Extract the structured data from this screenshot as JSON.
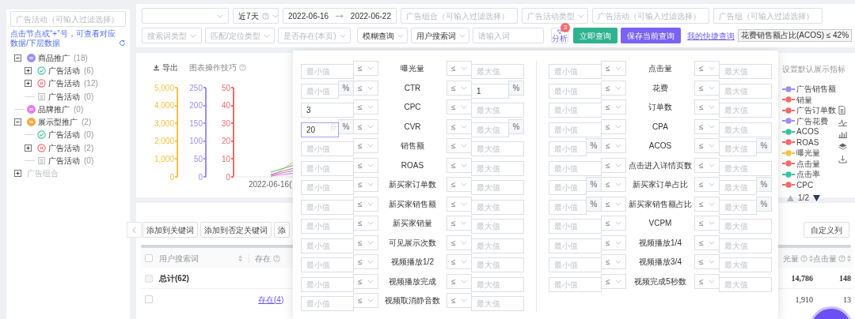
{
  "sidebar": {
    "search": {
      "placeholder": "广告活动（可输入过滤选择）"
    },
    "hint": "点击节点或“+”号，可查看对应数据/下层数据",
    "tree": [
      {
        "label": "商品推广",
        "count": "(18)",
        "color": "#9d8df1",
        "disabled": false,
        "expanded": true,
        "children": [
          {
            "label": "广告活动",
            "count": "(6)",
            "kind": "enabled",
            "expanded": false
          },
          {
            "label": "广告活动",
            "count": "(12)",
            "kind": "paused",
            "expanded": false
          },
          {
            "label": "广告活动",
            "count": "(0)",
            "kind": "archived"
          }
        ]
      },
      {
        "label": "品牌推广",
        "count": "(0)",
        "color": "#e879f9",
        "disabled": false
      },
      {
        "label": "展示型推广",
        "count": "(2)",
        "color": "#f5a742",
        "disabled": false,
        "expanded": true,
        "children": [
          {
            "label": "广告活动",
            "count": "(0)",
            "kind": "enabled"
          },
          {
            "label": "广告活动",
            "count": "(2)",
            "kind": "paused",
            "expanded": false
          },
          {
            "label": "广告活动",
            "count": "(0)",
            "kind": "archived"
          }
        ]
      },
      {
        "label": "广告组合",
        "disabled": true,
        "expanded": false
      }
    ]
  },
  "filters": {
    "row1": [
      {
        "kind": "select"
      },
      {
        "kind": "select",
        "value": "近7天",
        "help": true
      },
      {
        "kind": "date_range",
        "start": "2022-06-16",
        "end": "2022-06-22"
      },
      {
        "kind": "input",
        "placeholder": "广告组合（可输入过滤选择）"
      },
      {
        "kind": "select",
        "placeholder": "广告活动类型"
      },
      {
        "kind": "input",
        "placeholder": "广告活动（可输入过滤选择）"
      },
      {
        "kind": "input",
        "placeholder": "广告组（可输入过滤选择）"
      }
    ],
    "row2": [
      {
        "kind": "select",
        "placeholder": "搜索词类型"
      },
      {
        "kind": "select",
        "placeholder": "匹配/定位类型"
      },
      {
        "kind": "select",
        "placeholder": "是否存在(本页)"
      },
      {
        "kind": "select",
        "value": "模糊查询"
      },
      {
        "kind": "select",
        "value": "用户搜索词"
      },
      {
        "kind": "input",
        "placeholder": "请输入词"
      }
    ],
    "analyze": {
      "label": "分析",
      "badge": "3"
    },
    "buttons": [
      {
        "label": "立即查询",
        "kind": "primary"
      },
      {
        "label": "保存当前查询",
        "kind": "accent"
      }
    ],
    "quick_link": "我的快捷查询",
    "quick_tag": "花费销售额占比(ACOS) ≤ 42%"
  },
  "chart": {
    "toolbar": [
      {
        "kind": "export",
        "label": "导出"
      },
      {
        "kind": "tips",
        "label": "图表操作技巧"
      }
    ],
    "axes": [
      {
        "color": "#f5c342",
        "ticks": [
          "5,000",
          "4,000",
          "3,000",
          "2,000",
          "1,000",
          "0"
        ]
      },
      {
        "color": "#9d8df1",
        "ticks": [
          "250",
          "200",
          "150",
          "100",
          "50",
          "0"
        ]
      },
      {
        "color": "#ef6b6b",
        "ticks": [
          "50",
          "40",
          "30",
          "20",
          "10",
          "0"
        ]
      }
    ],
    "x_label": "2022-06-16(",
    "legend_title": "设置默认展示指标",
    "legend": [
      {
        "label": "广告销售额",
        "color": "#9d8df1"
      },
      {
        "label": "销量",
        "color": "#ef6b6b"
      },
      {
        "label": "广告订单数",
        "color": "#ef6b6b"
      },
      {
        "label": "广告花费",
        "color": "#9d8df1"
      },
      {
        "label": "ACOS",
        "color": "#3cc0a0"
      },
      {
        "label": "ROAS",
        "color": "#ef6b6b"
      },
      {
        "label": "曝光量",
        "color": "#f5c342"
      },
      {
        "label": "点击量",
        "color": "#ef6b6b"
      },
      {
        "label": "点击率",
        "color": "#3cc0a0"
      },
      {
        "label": "CPC",
        "color": "#ef6b6b"
      }
    ],
    "pager": "1/2"
  },
  "table": {
    "buttons": [
      "添加到关键词",
      "添加到否定关键词",
      "添"
    ],
    "custom_button": "自定义列",
    "header_checkbox": {
      "checked": false
    },
    "columns_left": [
      {
        "label": "用户搜索词",
        "sortable": true
      },
      {
        "label": "存在",
        "help": true
      }
    ],
    "columns_right": [
      {
        "label": "光量"
      },
      {
        "label": "点击量"
      }
    ],
    "total": {
      "label": "总计(62)",
      "checked": false,
      "disabled": true,
      "values": [
        "14,786",
        "148"
      ]
    },
    "rows": [
      {
        "exists": "存在(4)",
        "checked": false,
        "values": [
          "1,910",
          "13"
        ]
      }
    ]
  },
  "popover": {
    "columns": [
      [
        {
          "label": "曝光量",
          "min": {
            "placeholder": "最小值"
          },
          "max": {
            "placeholder": "最大值"
          }
        },
        {
          "label": "CTR",
          "min": {
            "placeholder": "最小值",
            "percent": true
          },
          "max": {
            "value": "1",
            "percent": true
          }
        },
        {
          "label": "CPC",
          "min": {
            "value": "3"
          },
          "max": {
            "placeholder": "最大值"
          }
        },
        {
          "label": "CVR",
          "min": {
            "value": "20",
            "percent": true,
            "focused": true
          },
          "max": {
            "placeholder": "最大值",
            "percent": true
          }
        },
        {
          "label": "销售额",
          "min": {
            "placeholder": "最小值"
          },
          "max": {
            "placeholder": "最大值"
          }
        },
        {
          "label": "ROAS",
          "min": {
            "placeholder": "最小值"
          },
          "max": {
            "placeholder": "最大值"
          }
        },
        {
          "label": "新买家订单数",
          "min": {
            "placeholder": "最小值"
          },
          "max": {
            "placeholder": "最大值"
          }
        },
        {
          "label": "新买家销售额",
          "min": {
            "placeholder": "最小值"
          },
          "max": {
            "placeholder": "最大值"
          }
        },
        {
          "label": "新买家销量",
          "min": {
            "placeholder": "最小值"
          },
          "max": {
            "placeholder": "最大值"
          }
        },
        {
          "label": "可见展示次数",
          "min": {
            "placeholder": "最小值"
          },
          "max": {
            "placeholder": "最大值"
          }
        },
        {
          "label": "视频播放1/2",
          "min": {
            "placeholder": "最小值"
          },
          "max": {
            "placeholder": "最大值"
          }
        },
        {
          "label": "视频播放完成",
          "min": {
            "placeholder": "最小值"
          },
          "max": {
            "placeholder": "最大值"
          }
        },
        {
          "label": "视频取消静音数",
          "min": {
            "placeholder": "最小值"
          },
          "max": {
            "placeholder": "最大值"
          }
        }
      ],
      [
        {
          "label": "点击量",
          "min": {
            "placeholder": "最小值"
          },
          "max": {
            "placeholder": "最大值"
          }
        },
        {
          "label": "花费",
          "min": {
            "placeholder": "最小值"
          },
          "max": {
            "placeholder": "最大值"
          }
        },
        {
          "label": "订单数",
          "min": {
            "placeholder": "最小值"
          },
          "max": {
            "placeholder": "最大值"
          }
        },
        {
          "label": "CPA",
          "min": {
            "placeholder": "最小值"
          },
          "max": {
            "placeholder": "最大值"
          }
        },
        {
          "label": "ACOS",
          "min": {
            "placeholder": "最小值",
            "percent": true
          },
          "max": {
            "placeholder": "最大值",
            "percent": true
          }
        },
        {
          "label": "点击进入详情页数",
          "min": {
            "placeholder": "最小值"
          },
          "max": {
            "placeholder": "最大值"
          }
        },
        {
          "label": "新买家订单占比",
          "min": {
            "placeholder": "最小值",
            "percent": true
          },
          "max": {
            "placeholder": "最大值",
            "percent": true
          }
        },
        {
          "label": "新买家销售额占比",
          "min": {
            "placeholder": "最小值",
            "percent": true
          },
          "max": {
            "placeholder": "最大值",
            "percent": true
          }
        },
        {
          "label": "VCPM",
          "min": {
            "placeholder": "最小值"
          },
          "max": {
            "placeholder": "最大值"
          }
        },
        {
          "label": "视频播放1/4",
          "min": {
            "placeholder": "最小值"
          },
          "max": {
            "placeholder": "最大值"
          }
        },
        {
          "label": "视频播放3/4",
          "min": {
            "placeholder": "最小值"
          },
          "max": {
            "placeholder": "最大值"
          }
        },
        {
          "label": "视频完成5秒数",
          "min": {
            "placeholder": "最小值"
          },
          "max": {
            "placeholder": "最大值"
          }
        }
      ]
    ],
    "operator": "≤",
    "unit": "%"
  }
}
